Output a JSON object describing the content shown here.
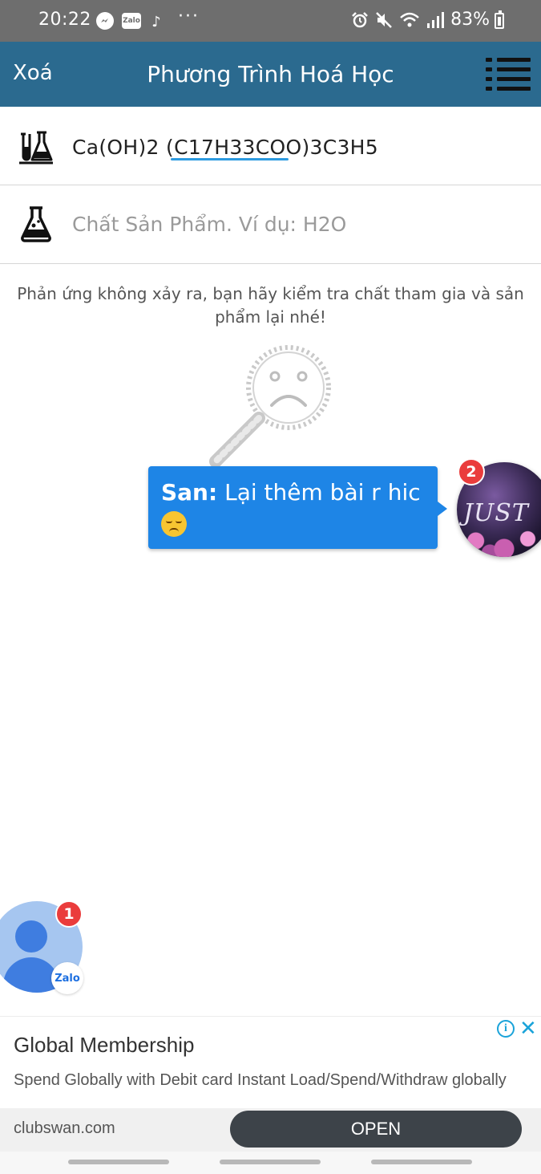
{
  "status_bar": {
    "time": "20:22",
    "notification_icons": [
      "messenger-icon",
      "zalo-icon",
      "tiktok-icon",
      "more-dots-icon"
    ],
    "more_dots": "···",
    "zalo_label": "Zalo",
    "battery_percent": "83%"
  },
  "app_bar": {
    "clear_label": "Xoá",
    "title": "Phương Trình Hoá Học",
    "background_color": "#2b6a8f"
  },
  "reactants": {
    "value": "Ca(OH)2 (C17H33COO)3C3H5"
  },
  "products": {
    "placeholder": "Chất Sản Phẩm. Ví dụ: H2O"
  },
  "result_message": "Phản ứng không xảy ra, bạn hãy kiểm tra chất tham gia và sản phẩm lại nhé!",
  "chat_bubble": {
    "sender": "San:",
    "text": "Lại thêm bài r hic",
    "emoji": "disappointed-face-emoji",
    "background_color": "#1e85e6"
  },
  "chat_head": {
    "badge_count": "2",
    "avatar_text": "JUST"
  },
  "zalo_bubble": {
    "badge_count": "1",
    "label": "Zalo"
  },
  "ad": {
    "title": "Global Membership",
    "description": "Spend Globally with Debit card Instant Load/Spend/Withdraw globally",
    "domain": "clubswan.com",
    "cta": "OPEN",
    "info_icon_label": "i",
    "close_icon_label": "✕"
  }
}
